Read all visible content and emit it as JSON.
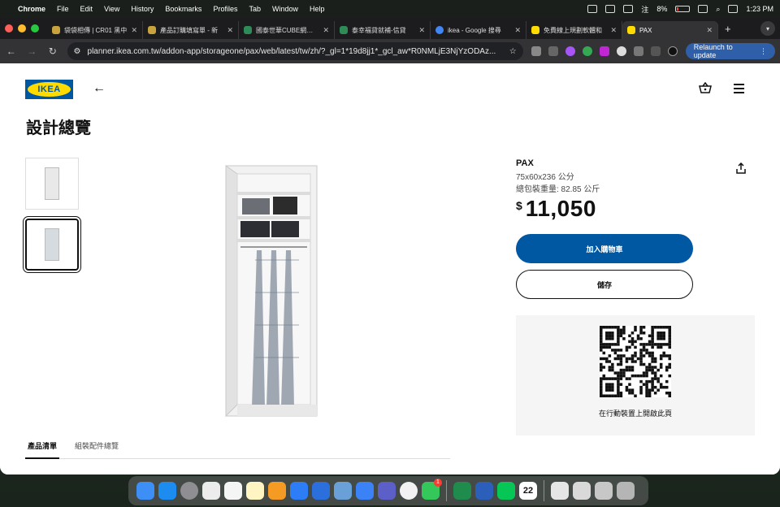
{
  "menubar": {
    "app": "Chrome",
    "items": [
      "File",
      "Edit",
      "View",
      "History",
      "Bookmarks",
      "Profiles",
      "Tab",
      "Window",
      "Help"
    ],
    "battery": "8%",
    "ime": "注",
    "clock": "1:23 PM"
  },
  "tabs": [
    {
      "title": "袋袋相傳 | CR01 黑中"
    },
    {
      "title": "產品訂購填寫單 - 新"
    },
    {
      "title": "國泰世華CUBE網路銀"
    },
    {
      "title": "泰幸福貸就補-信貸"
    },
    {
      "title": "ikea - Google 搜尋"
    },
    {
      "title": "免費線上規劃軟體和"
    },
    {
      "title": "PAX"
    }
  ],
  "toolbar": {
    "url": "planner.ikea.com.tw/addon-app/storageone/pax/web/latest/tw/zh/?_gl=1*19d8jj1*_gcl_aw*R0NMLjE3NjYzODAz...",
    "relaunch": "Relaunch to update"
  },
  "page": {
    "logo": "IKEA",
    "title": "設計總覽",
    "product": {
      "name": "PAX",
      "dimensions": "75x60x236 公分",
      "weight": "總包裝重量: 82.85 公斤",
      "currency": "$",
      "price": "11,050"
    },
    "add_to_cart": "加入購物車",
    "save": "儲存",
    "qr_caption": "在行動裝置上開啟此頁",
    "bottom_tabs": [
      "產品清單",
      "組裝配件總覽"
    ]
  },
  "dock": {
    "calendar_day": "22",
    "messages_badge": "1"
  }
}
